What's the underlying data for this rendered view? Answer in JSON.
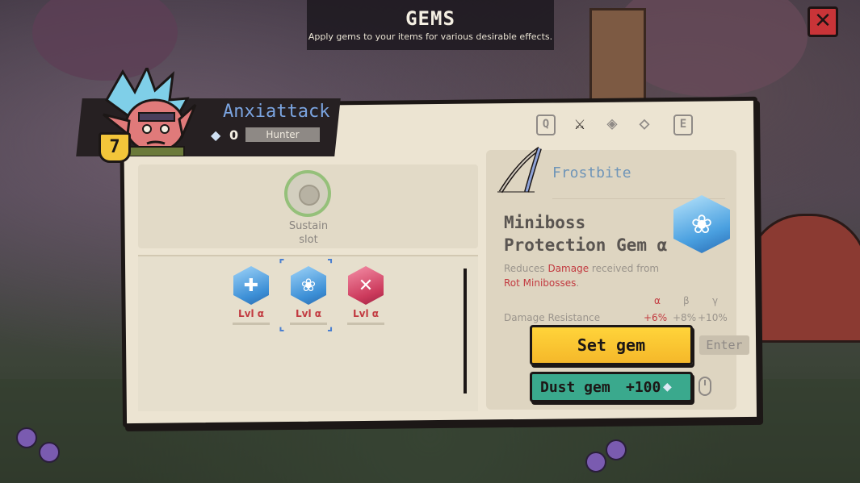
{
  "screen": {
    "title": "GEMS",
    "subtitle": "Apply gems to your items for various desirable effects."
  },
  "player": {
    "name": "Anxiattack",
    "level": "7",
    "currency": "0",
    "class_name": "Hunter"
  },
  "tabs": [
    {
      "label": "Q",
      "icon": "key-q"
    },
    {
      "label": "",
      "icon": "crossed-axes-icon",
      "active": true
    },
    {
      "label": "",
      "icon": "gem-search-icon"
    },
    {
      "label": "",
      "icon": "gem-add-icon"
    },
    {
      "label": "E",
      "icon": "key-e"
    }
  ],
  "slot": {
    "label_line1": "Sustain",
    "label_line2": "slot"
  },
  "gems": [
    {
      "level": "Lvl α",
      "icon": "plus-gem-icon",
      "color": "#3c8fd6"
    },
    {
      "level": "Lvl α",
      "icon": "paw-gem-icon",
      "color": "#3c8fd6",
      "selected": true
    },
    {
      "level": "Lvl α",
      "icon": "broken-gem-icon",
      "color": "#cc3a5c"
    }
  ],
  "item": {
    "name": "Frostbite",
    "icon": "bow-icon"
  },
  "selected_gem": {
    "title_line1": "Miniboss",
    "title_line2": "Protection Gem α",
    "desc_pre": "Reduces ",
    "desc_hl1": "Damage",
    "desc_mid": " received from",
    "desc_hl2": "Rot Minibosses",
    "desc_post": ".",
    "tiers": [
      "α",
      "β",
      "γ"
    ],
    "stat_label": "Damage Resistance",
    "stat_values": [
      "+6%",
      "+8%",
      "+10%"
    ]
  },
  "actions": {
    "set_label": "Set gem",
    "enter_hint": "Enter",
    "dust_label": "Dust gem",
    "dust_amount": "+100"
  },
  "colors": {
    "accent_yellow": "#f5b82a",
    "accent_teal": "#3aa98d",
    "highlight_red": "#c23a40",
    "name_blue": "#7ba4e0"
  }
}
